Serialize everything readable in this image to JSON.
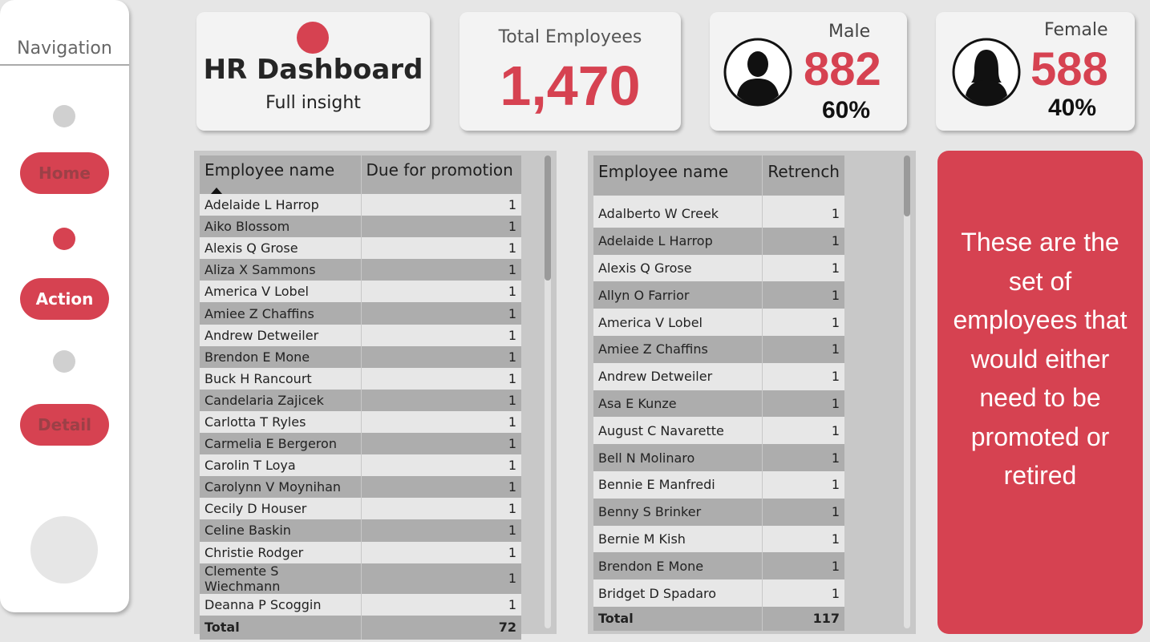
{
  "navigation": {
    "title": "Navigation",
    "buttons": [
      {
        "label": "Home"
      },
      {
        "label": "Action"
      },
      {
        "label": "Detail"
      }
    ]
  },
  "header": {
    "title": "HR Dashboard",
    "subtitle": "Full insight"
  },
  "kpis": {
    "total_label": "Total Employees",
    "total_value": "1,470",
    "male_label": "Male",
    "male_value": "882",
    "male_pct": "60%",
    "female_label": "Female",
    "female_value": "588",
    "female_pct": "40%"
  },
  "colors": {
    "accent": "#d64251",
    "background": "#e6e6e6"
  },
  "promotion_table": {
    "headers": [
      "Employee name",
      "Due for promotion"
    ],
    "rows": [
      [
        "Adelaide L Harrop",
        "1"
      ],
      [
        "Aiko Blossom",
        "1"
      ],
      [
        "Alexis Q Grose",
        "1"
      ],
      [
        "Aliza X Sammons",
        "1"
      ],
      [
        "America V Lobel",
        "1"
      ],
      [
        "Amiee Z Chaffins",
        "1"
      ],
      [
        "Andrew Detweiler",
        "1"
      ],
      [
        "Brendon E Mone",
        "1"
      ],
      [
        "Buck H Rancourt",
        "1"
      ],
      [
        "Candelaria Zajicek",
        "1"
      ],
      [
        "Carlotta T Ryles",
        "1"
      ],
      [
        "Carmelia E Bergeron",
        "1"
      ],
      [
        "Carolin T Loya",
        "1"
      ],
      [
        "Carolynn V Moynihan",
        "1"
      ],
      [
        "Cecily D Houser",
        "1"
      ],
      [
        "Celine Baskin",
        "1"
      ],
      [
        "Christie Rodger",
        "1"
      ],
      [
        "Clemente S Wiechmann",
        "1"
      ],
      [
        "Deanna P Scoggin",
        "1"
      ]
    ],
    "total_label": "Total",
    "total_value": "72"
  },
  "retrench_table": {
    "headers": [
      "Employee name",
      "Retrench"
    ],
    "rows": [
      [
        "Adalberto W Creek",
        "1"
      ],
      [
        "Adelaide L Harrop",
        "1"
      ],
      [
        "Alexis Q Grose",
        "1"
      ],
      [
        "Allyn O Farrior",
        "1"
      ],
      [
        "America V Lobel",
        "1"
      ],
      [
        "Amiee Z Chaffins",
        "1"
      ],
      [
        "Andrew Detweiler",
        "1"
      ],
      [
        "Asa E Kunze",
        "1"
      ],
      [
        "August C Navarette",
        "1"
      ],
      [
        "Bell N Molinaro",
        "1"
      ],
      [
        "Bennie E Manfredi",
        "1"
      ],
      [
        "Benny S Brinker",
        "1"
      ],
      [
        "Bernie M Kish",
        "1"
      ],
      [
        "Brendon E Mone",
        "1"
      ],
      [
        "Bridget D Spadaro",
        "1"
      ]
    ],
    "total_label": "Total",
    "total_value": "117"
  },
  "info": {
    "text": "These are the set of employees that would either need to be promoted or retired"
  }
}
